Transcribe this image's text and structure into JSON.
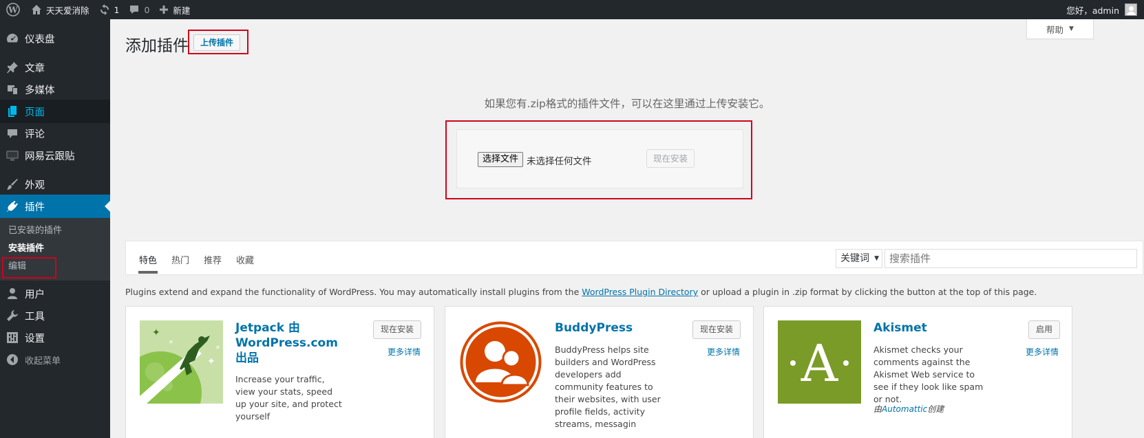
{
  "adminbar": {
    "site_name": "天天爱消除",
    "updates_count": "1",
    "comments_count": "0",
    "new_label": "新建",
    "greeting": "您好，admin"
  },
  "sidebar": {
    "items": [
      {
        "label": "仪表盘",
        "icon": "dashboard-icon"
      },
      {
        "label": "文章",
        "icon": "pin-icon"
      },
      {
        "label": "多媒体",
        "icon": "media-icon"
      },
      {
        "label": "页面",
        "icon": "page-icon"
      },
      {
        "label": "评论",
        "icon": "comment-icon"
      },
      {
        "label": "网易云跟贴",
        "icon": "screen-icon"
      },
      {
        "label": "外观",
        "icon": "brush-icon"
      },
      {
        "label": "插件",
        "icon": "plugin-icon"
      },
      {
        "label": "用户",
        "icon": "user-icon"
      },
      {
        "label": "工具",
        "icon": "wrench-icon"
      },
      {
        "label": "设置",
        "icon": "settings-icon"
      }
    ],
    "plugin_submenu": [
      "已安装的插件",
      "安装插件",
      "编辑"
    ],
    "collapse_label": "收起菜单"
  },
  "header": {
    "title": "添加插件",
    "upload_button": "上传插件",
    "help_label": "帮助"
  },
  "upload": {
    "description": "如果您有.zip格式的插件文件，可以在这里通过上传安装它。",
    "choose_file_label": "选择文件",
    "file_status": "未选择任何文件",
    "install_now_label": "现在安装"
  },
  "filter": {
    "tabs": [
      "特色",
      "热门",
      "推荐",
      "收藏"
    ],
    "search_type": "关键词",
    "search_placeholder": "搜索插件"
  },
  "intro": {
    "text_before": "Plugins extend and expand the functionality of WordPress. You may automatically install plugins from the ",
    "link_text": "WordPress Plugin Directory",
    "text_after": " or upload a plugin in .zip format by clicking the button at the top of this page."
  },
  "plugins": [
    {
      "name": "Jetpack 由 WordPress.com 出品",
      "description": "Increase your traffic, view your stats, speed up your site, and protect yourself",
      "action_label": "现在安装",
      "more_label": "更多详情"
    },
    {
      "name": "BuddyPress",
      "description": "BuddyPress helps site builders and WordPress developers add community features to their websites, with user profile fields, activity streams, messagin",
      "action_label": "现在安装",
      "more_label": "更多详情"
    },
    {
      "name": "Akismet",
      "description": "Akismet checks your comments against the Akismet Web service to see if they look like spam or not.",
      "action_label": "启用",
      "more_label": "更多详情",
      "author_prefix": "由",
      "author": "Automattic",
      "author_suffix": "创建"
    }
  ],
  "colors": {
    "admin_dark": "#23282d",
    "accent": "#0073aa",
    "highlight_box": "#d0021b",
    "buddypress": "#d84800",
    "akismet": "#7b9b28"
  }
}
